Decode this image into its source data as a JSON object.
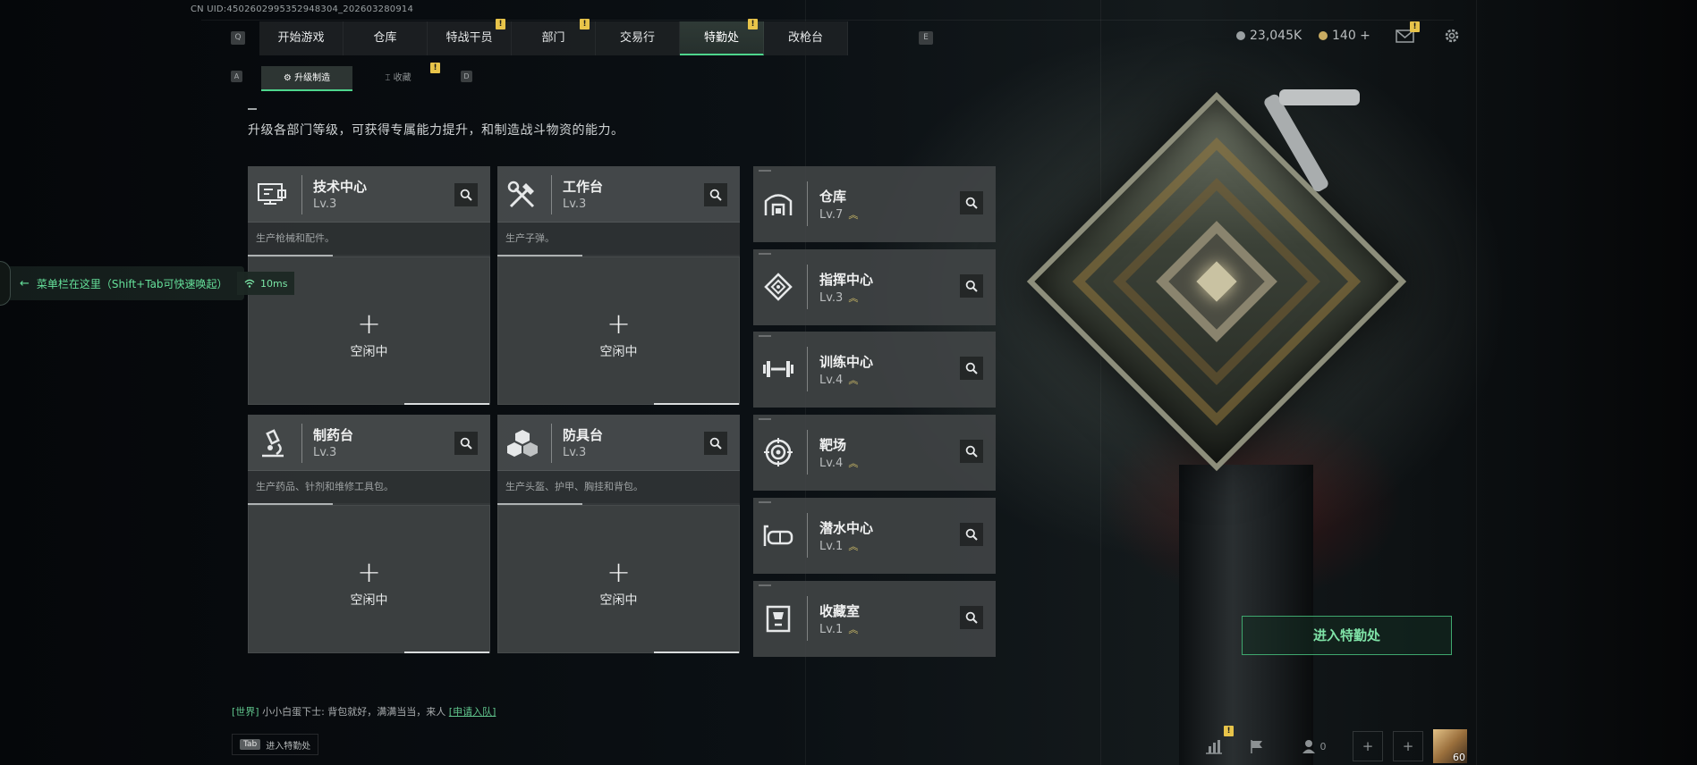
{
  "uid": "CN UID:4502602995352948304_202603280914",
  "top_tabs": [
    {
      "label": "开始游戏",
      "active": false,
      "badge": ""
    },
    {
      "label": "仓库",
      "active": false,
      "badge": ""
    },
    {
      "label": "特战干员",
      "active": false,
      "badge": "!"
    },
    {
      "label": "部门",
      "active": false,
      "badge": "!"
    },
    {
      "label": "交易行",
      "active": false,
      "badge": ""
    },
    {
      "label": "特勤处",
      "active": true,
      "badge": "!"
    },
    {
      "label": "改枪台",
      "active": false,
      "badge": ""
    }
  ],
  "key_hints": {
    "left": "Q",
    "right": "E",
    "sub_left": "A",
    "sub_right": "D"
  },
  "resources": {
    "currency": "23,045K",
    "coins": "140 +"
  },
  "mail_badge": "!",
  "sub_tabs": [
    {
      "label": "升级制造",
      "active": true,
      "badge": ""
    },
    {
      "label": "收藏",
      "active": false,
      "badge": "!"
    }
  ],
  "description": "升级各部门等级，可获得专属能力提升，和制造战斗物资的能力。",
  "production": [
    {
      "name": "技术中心",
      "level": "Lv.3",
      "desc": "生产枪械和配件。",
      "status": "空闲中",
      "icon": "computer-icon"
    },
    {
      "name": "工作台",
      "level": "Lv.3",
      "desc": "生产子弹。",
      "status": "空闲中",
      "icon": "tools-icon"
    },
    {
      "name": "制药台",
      "level": "Lv.3",
      "desc": "生产药品、针剂和维修工具包。",
      "status": "空闲中",
      "icon": "microscope-icon"
    },
    {
      "name": "防具台",
      "level": "Lv.3",
      "desc": "生产头盔、护甲、胸挂和背包。",
      "status": "空闲中",
      "icon": "cubes-icon"
    }
  ],
  "facilities": [
    {
      "name": "仓库",
      "level": "Lv.7",
      "icon": "warehouse-icon",
      "upgradable": true
    },
    {
      "name": "指挥中心",
      "level": "Lv.3",
      "icon": "chip-icon",
      "upgradable": true
    },
    {
      "name": "训练中心",
      "level": "Lv.4",
      "icon": "dumbbell-icon",
      "upgradable": true
    },
    {
      "name": "靶场",
      "level": "Lv.4",
      "icon": "target-icon",
      "upgradable": true
    },
    {
      "name": "潜水中心",
      "level": "Lv.1",
      "icon": "diving-mask-icon",
      "upgradable": true
    },
    {
      "name": "收藏室",
      "level": "Lv.1",
      "icon": "trophy-icon",
      "upgradable": true
    }
  ],
  "upgrade_symbol": "︽",
  "enter_button": "进入特勤处",
  "menu_hint": "菜单栏在这里（Shift+Tab可快速唤起）",
  "ping": "10ms",
  "chat": {
    "channel": "[世界]",
    "message": "小小白蛋下士: 背包就好，满满当当，来人",
    "link": "[申请入队]"
  },
  "tab_hint": {
    "key": "Tab",
    "label": "进入特勤处"
  },
  "bottom": {
    "stats_badge": "!",
    "friends_count": "0",
    "player_level": "60"
  },
  "colors": {
    "accent": "#4ed68d",
    "badge": "#e8c44a",
    "upgrade": "#d9c56a"
  }
}
